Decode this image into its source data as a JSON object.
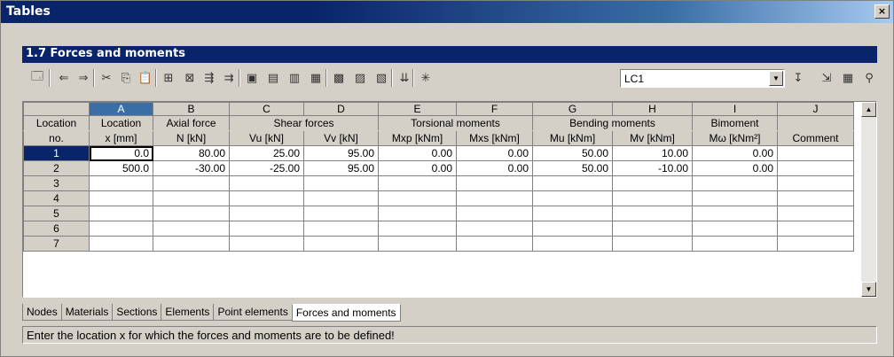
{
  "window": {
    "title": "Tables",
    "close_label": "×"
  },
  "panel": {
    "title": "1.7 Forces and moments"
  },
  "toolbar": {
    "buttons": [
      {
        "name": "properties-icon",
        "glyph": "🗔"
      },
      {
        "name": "prev-table-icon",
        "glyph": "⇐"
      },
      {
        "name": "next-table-icon",
        "glyph": "⇒"
      },
      {
        "name": "cut-icon",
        "glyph": "✂"
      },
      {
        "name": "copy-icon",
        "glyph": "⎘"
      },
      {
        "name": "paste-icon",
        "glyph": "📋"
      },
      {
        "name": "insert-row-icon",
        "glyph": "⊞"
      },
      {
        "name": "delete-row-icon",
        "glyph": "⊠"
      },
      {
        "name": "insert-col-icon",
        "glyph": "⇶"
      },
      {
        "name": "append-col-icon",
        "glyph": "⇉"
      },
      {
        "name": "view1-icon",
        "glyph": "▣"
      },
      {
        "name": "view2-icon",
        "glyph": "▤"
      },
      {
        "name": "view3-icon",
        "glyph": "▥"
      },
      {
        "name": "view4-icon",
        "glyph": "▦"
      },
      {
        "name": "export-icon",
        "glyph": "▩"
      },
      {
        "name": "import-icon",
        "glyph": "▨"
      },
      {
        "name": "print-icon",
        "glyph": "▧"
      },
      {
        "name": "rs-icon",
        "glyph": "⇊"
      },
      {
        "name": "new-lc-icon",
        "glyph": "✳"
      }
    ],
    "load_case": "LC1",
    "right_buttons": [
      {
        "name": "lc-pick-icon",
        "glyph": "↧"
      },
      {
        "name": "graphic-icon",
        "glyph": "⇲"
      },
      {
        "name": "result-icon",
        "glyph": "▦"
      },
      {
        "name": "search-icon",
        "glyph": "⚲"
      }
    ]
  },
  "grid": {
    "letters": [
      "A",
      "B",
      "C",
      "D",
      "E",
      "F",
      "G",
      "H",
      "I",
      "J"
    ],
    "header_row1": {
      "location_no": "Location",
      "location": "Location",
      "axial": "Axial force",
      "shear": "Shear forces",
      "torsional": "Torsional moments",
      "bending": "Bending moments",
      "bimoment": "Bimoment",
      "comment_blank": ""
    },
    "header_row2": {
      "location_no": "no.",
      "x": "x [mm]",
      "n": "N [kN]",
      "vu": "Vu [kN]",
      "vv": "Vv [kN]",
      "mxp": "Mxp [kNm]",
      "mxs": "Mxs [kNm]",
      "mu": "Mu [kNm]",
      "mv": "Mv [kNm]",
      "mw": "Mω [kNm²]",
      "comment": "Comment"
    },
    "rows": [
      {
        "no": "1",
        "cells": [
          "0.0",
          "80.00",
          "25.00",
          "95.00",
          "0.00",
          "0.00",
          "50.00",
          "10.00",
          "0.00",
          ""
        ]
      },
      {
        "no": "2",
        "cells": [
          "500.0",
          "-30.00",
          "-25.00",
          "95.00",
          "0.00",
          "0.00",
          "50.00",
          "-10.00",
          "0.00",
          ""
        ]
      },
      {
        "no": "3",
        "cells": [
          "",
          "",
          "",
          "",
          "",
          "",
          "",
          "",
          "",
          ""
        ]
      },
      {
        "no": "4",
        "cells": [
          "",
          "",
          "",
          "",
          "",
          "",
          "",
          "",
          "",
          ""
        ]
      },
      {
        "no": "5",
        "cells": [
          "",
          "",
          "",
          "",
          "",
          "",
          "",
          "",
          "",
          ""
        ]
      },
      {
        "no": "6",
        "cells": [
          "",
          "",
          "",
          "",
          "",
          "",
          "",
          "",
          "",
          ""
        ]
      },
      {
        "no": "7",
        "cells": [
          "",
          "",
          "",
          "",
          "",
          "",
          "",
          "",
          "",
          ""
        ]
      }
    ]
  },
  "tabs": [
    "Nodes",
    "Materials",
    "Sections",
    "Elements",
    "Point elements",
    "Forces and moments"
  ],
  "active_tab": "Forces and moments",
  "status": "Enter the location x for which the forces and moments are to be defined!"
}
